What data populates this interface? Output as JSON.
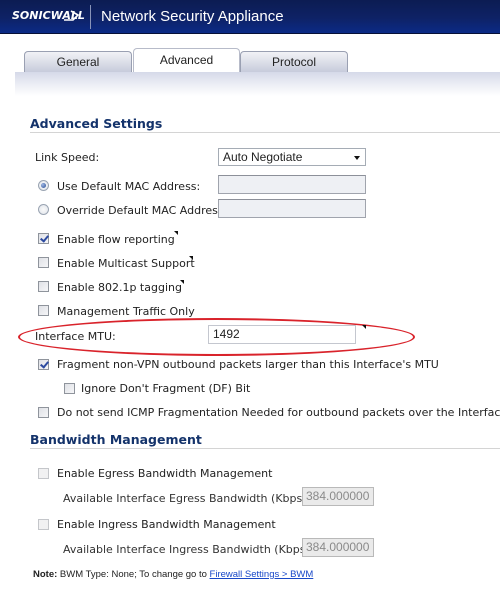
{
  "header": {
    "logo_text": "SONICWALL",
    "title": "Network Security Appliance",
    "background_color": "#0e2266"
  },
  "tabs": [
    {
      "label": "General",
      "active": false
    },
    {
      "label": "Advanced",
      "active": true
    },
    {
      "label": "Protocol",
      "active": false
    }
  ],
  "advanced_settings": {
    "title": "Advanced Settings",
    "link_speed": {
      "label": "Link Speed:",
      "value": "Auto Negotiate"
    },
    "mac_options": [
      {
        "label": "Use Default MAC Address:",
        "selected": true,
        "value": ""
      },
      {
        "label": "Override Default MAC Address:",
        "selected": false,
        "value": ""
      }
    ],
    "checkboxes": [
      {
        "label": "Enable flow reporting",
        "checked": true,
        "has_tooltip": true
      },
      {
        "label": "Enable Multicast Support",
        "checked": false,
        "has_tooltip": true
      },
      {
        "label": "Enable 802.1p tagging",
        "checked": false,
        "has_tooltip": true
      },
      {
        "label": "Management Traffic Only",
        "checked": false,
        "has_tooltip": false
      }
    ],
    "mtu": {
      "label": "Interface MTU:",
      "value": "1492",
      "highlighted": true,
      "highlight_color": "#d9232b"
    },
    "fragment": {
      "label": "Fragment non-VPN outbound packets larger than this Interface's MTU",
      "checked": true
    },
    "ignore_df": {
      "label": "Ignore Don't Fragment (DF) Bit",
      "checked": false
    },
    "no_icmp": {
      "label": "Do not send ICMP Fragmentation Needed for outbound packets over the Interface MTU",
      "checked": false
    }
  },
  "bandwidth_management": {
    "title": "Bandwidth Management",
    "egress": {
      "checkbox_label": "Enable Egress Bandwidth Management",
      "checked": false,
      "field_label": "Available Interface Egress Bandwidth (Kbps):",
      "value": "384.000000"
    },
    "ingress": {
      "checkbox_label": "Enable Ingress Bandwidth Management",
      "checked": false,
      "field_label": "Available Interface Ingress Bandwidth (Kbps):",
      "value": "384.000000"
    },
    "note": {
      "prefix": "Note:",
      "text": " BWM Type: None; To change go to ",
      "link": "Firewall Settings > BWM"
    }
  }
}
